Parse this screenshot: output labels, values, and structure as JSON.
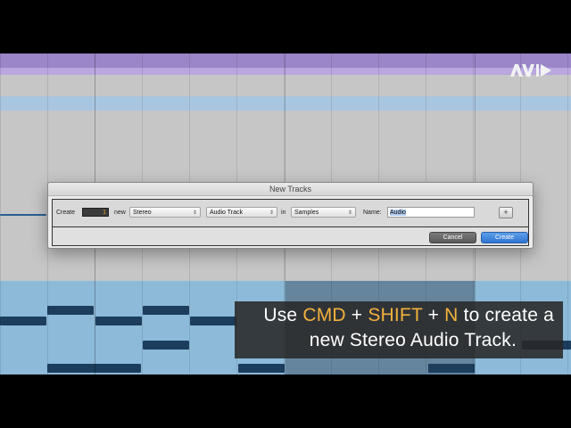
{
  "logo": "AVID",
  "dialog": {
    "title": "New Tracks",
    "create_label": "Create",
    "count": "1",
    "new_label": "new",
    "format": "Stereo",
    "track_type": "Audio Track",
    "in_label": "in",
    "timebase": "Samples",
    "name_label": "Name:",
    "name_value": "Audio",
    "add_row": "+",
    "cancel": "Cancel",
    "create": "Create"
  },
  "caption": {
    "line1": {
      "pre": "Use ",
      "k1": "CMD",
      "p1": " + ",
      "k2": "SHIFT",
      "p2": " + ",
      "k3": "N",
      "post": " to create a"
    },
    "line2": "new Stereo Audio Track."
  },
  "colors": {
    "accent_text": "#f4b13d",
    "create_button": "#2f75d4",
    "purple_track": "#9b86c9",
    "blue_track": "#8dbad9"
  }
}
